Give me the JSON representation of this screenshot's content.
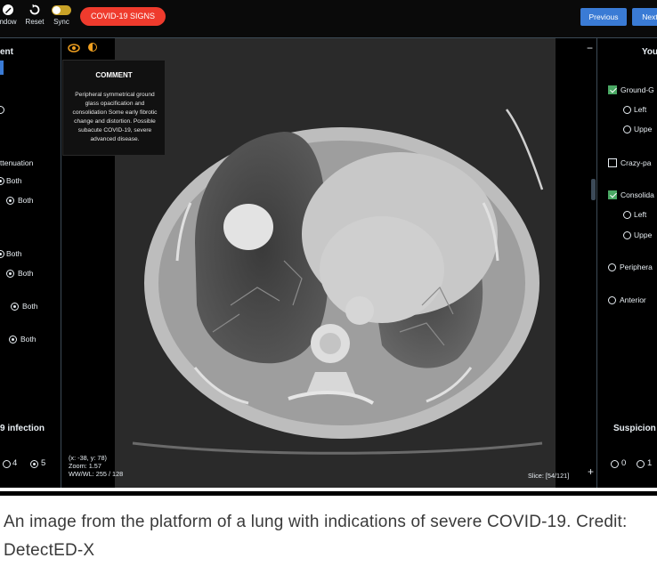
{
  "toolbar": {
    "window_label": "ndow",
    "reset_label": "Reset",
    "sync_label": "Sync",
    "covid_signs_label": "COVID-19 SIGNS",
    "previous_label": "Previous",
    "next_label": "Next"
  },
  "left_panel": {
    "header": "ent",
    "attenuation_label": "ttenuation",
    "options": [
      "Both",
      "Both",
      "Both",
      "Both",
      "Both",
      "Both"
    ],
    "infection_label": "9 infection",
    "score_options": [
      "4",
      "5"
    ]
  },
  "comment": {
    "title": "COMMENT",
    "text": "Peripheral symmetrical ground glass opacification and consolidation Some early fibrotic change and distortion. Possible subacute COVID-19, severe advanced disease."
  },
  "viewer": {
    "cursor_readout": "(x: -38, y: 78)",
    "zoom_readout": "Zoom: 1.57",
    "window_readout": "WW/WL: 255 / 128",
    "slice_readout": "Slice: [54/121]",
    "minus_symbol": "−",
    "plus_symbol": "+"
  },
  "right_panel": {
    "header": "You",
    "ground_glass_label": "Ground-G",
    "left_label": "Left",
    "upper_label": "Uppe",
    "crazy_paving_label": "Crazy-pa",
    "consolidation_label": "Consolida",
    "left_label_2": "Left",
    "upper_label_2": "Uppe",
    "peripheral_label": "Periphera",
    "anterior_label": "Anterior",
    "suspicion_label": "Suspicion",
    "score_options": [
      "0",
      "1"
    ]
  },
  "caption": "An image from the platform of a lung with indications of severe COVID-19. Credit: DetectED-X",
  "colors": {
    "accent_red": "#ef3b2d",
    "accent_blue": "#3a7bd5",
    "check_green": "#4aa864",
    "sync_yellow": "#c9a227"
  },
  "icons": [
    "pencil-icon",
    "reset-icon",
    "eye-icon",
    "brightness-icon"
  ]
}
